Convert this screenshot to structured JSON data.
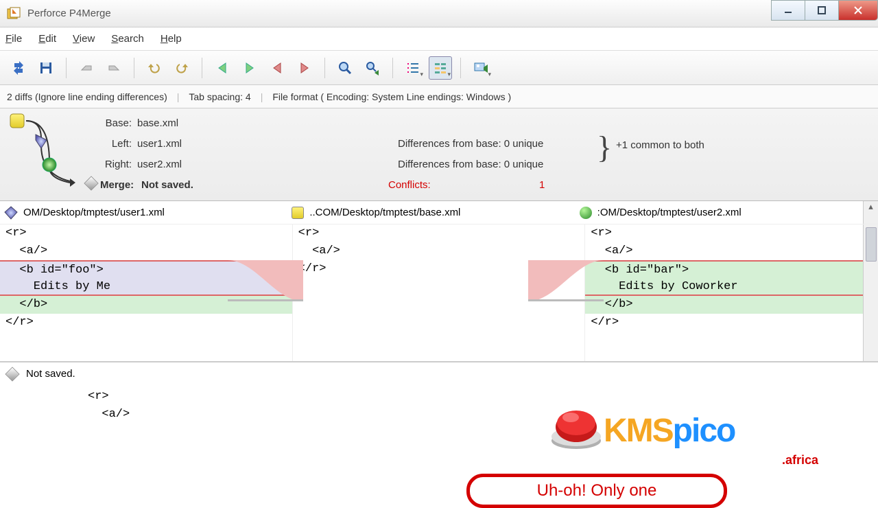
{
  "title": "Perforce P4Merge",
  "menu": {
    "file": "File",
    "edit": "Edit",
    "view": "View",
    "search": "Search",
    "help": "Help"
  },
  "status": {
    "diffs": "2 diffs (Ignore line ending differences)",
    "tab": "Tab spacing: 4",
    "format": "File format ( Encoding: System  Line endings: Windows )"
  },
  "files": {
    "base_label": "Base:",
    "base_value": "base.xml",
    "left_label": "Left:",
    "left_value": "user1.xml",
    "right_label": "Right:",
    "right_value": "user2.xml",
    "merge_label": "Merge:",
    "merge_value": "Not saved.",
    "left_diff": "Differences from base: 0 unique",
    "right_diff": "Differences from base: 0 unique",
    "common": "+1 common to both",
    "conflicts_label": "Conflicts:",
    "conflicts_count": "1"
  },
  "paths": {
    "left": "OM/Desktop/tmptest/user1.xml",
    "base": "..COM/Desktop/tmptest/base.xml",
    "right": ":OM/Desktop/tmptest/user2.xml"
  },
  "code": {
    "left": [
      "<r>",
      "  <a/>",
      "  <b id=\"foo\">",
      "    Edits by Me",
      "  </b>",
      "</r>"
    ],
    "base": [
      "<r>",
      "  <a/>",
      "</r>",
      "",
      "",
      ""
    ],
    "right": [
      "<r>",
      "  <a/>",
      "  <b id=\"bar\">",
      "    Edits by Coworker",
      "  </b>",
      "</r>"
    ]
  },
  "merge": {
    "header": "Not saved.",
    "lines": [
      "<r>",
      "  <a/>"
    ]
  },
  "overlay": {
    "logo1": "KMS",
    "logo2": "pico",
    "tag": ".africa",
    "callout": "Uh-oh! Only one"
  }
}
